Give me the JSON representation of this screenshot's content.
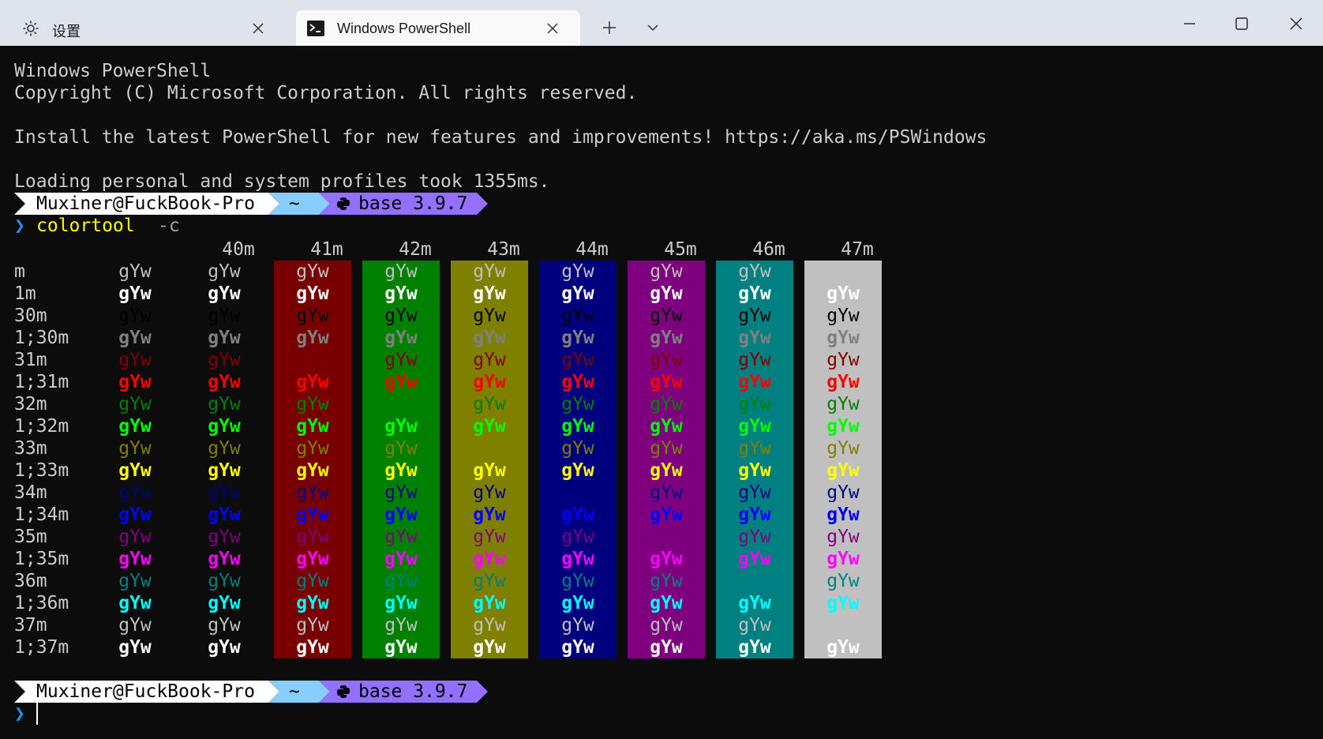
{
  "tabs": [
    {
      "label": "设置",
      "icon": "gear-icon"
    },
    {
      "label": "Windows PowerShell",
      "icon": "terminal-icon"
    }
  ],
  "window_controls": [
    "minimize-icon",
    "maximize-icon",
    "close-icon"
  ],
  "terminal": {
    "lines": [
      "Windows PowerShell",
      "Copyright (C) Microsoft Corporation. All rights reserved.",
      "",
      "Install the latest PowerShell for new features and improvements! https://aka.ms/PSWindows",
      "",
      "Loading personal and system profiles took 1355ms."
    ],
    "prompt": {
      "user_host": "Muxiner@FuckBook-Pro",
      "dir": "~",
      "env": "base 3.9.7",
      "arrow": "❯"
    },
    "command": {
      "name": "colortool",
      "args": "-c"
    },
    "color_table": {
      "sample": "gYw",
      "bg_codes": [
        "40m",
        "41m",
        "42m",
        "43m",
        "44m",
        "45m",
        "46m",
        "47m"
      ],
      "bg_colors": [
        "",
        "#780000",
        "#008000",
        "#7f7f00",
        "#00007f",
        "#7f007f",
        "#008080",
        "#c0c0c0"
      ],
      "rows": [
        {
          "code": "m",
          "fg": "#c0c0c0"
        },
        {
          "code": "1m",
          "fg": "#ffffff"
        },
        {
          "code": "30m",
          "fg": "#000000"
        },
        {
          "code": "1;30m",
          "fg": "#808080"
        },
        {
          "code": "31m",
          "fg": "#800000"
        },
        {
          "code": "1;31m",
          "fg": "#ff0000"
        },
        {
          "code": "32m",
          "fg": "#008000"
        },
        {
          "code": "1;32m",
          "fg": "#00ff00"
        },
        {
          "code": "33m",
          "fg": "#808000"
        },
        {
          "code": "1;33m",
          "fg": "#ffff00"
        },
        {
          "code": "34m",
          "fg": "#000080"
        },
        {
          "code": "1;34m",
          "fg": "#0000ff"
        },
        {
          "code": "35m",
          "fg": "#800080"
        },
        {
          "code": "1;35m",
          "fg": "#ff00ff"
        },
        {
          "code": "36m",
          "fg": "#008080"
        },
        {
          "code": "1;36m",
          "fg": "#00ffff"
        },
        {
          "code": "37m",
          "fg": "#c0c0c0"
        },
        {
          "code": "1;37m",
          "fg": "#ffffff"
        }
      ]
    }
  },
  "colors": {
    "prompt_user_bg": "#ffffff",
    "prompt_user_fg": "#000000",
    "prompt_dir_bg": "#87ceff",
    "prompt_env_bg": "#9370ff",
    "command_fg": "#ffff00",
    "arrow_fg": "#1e90ff"
  }
}
